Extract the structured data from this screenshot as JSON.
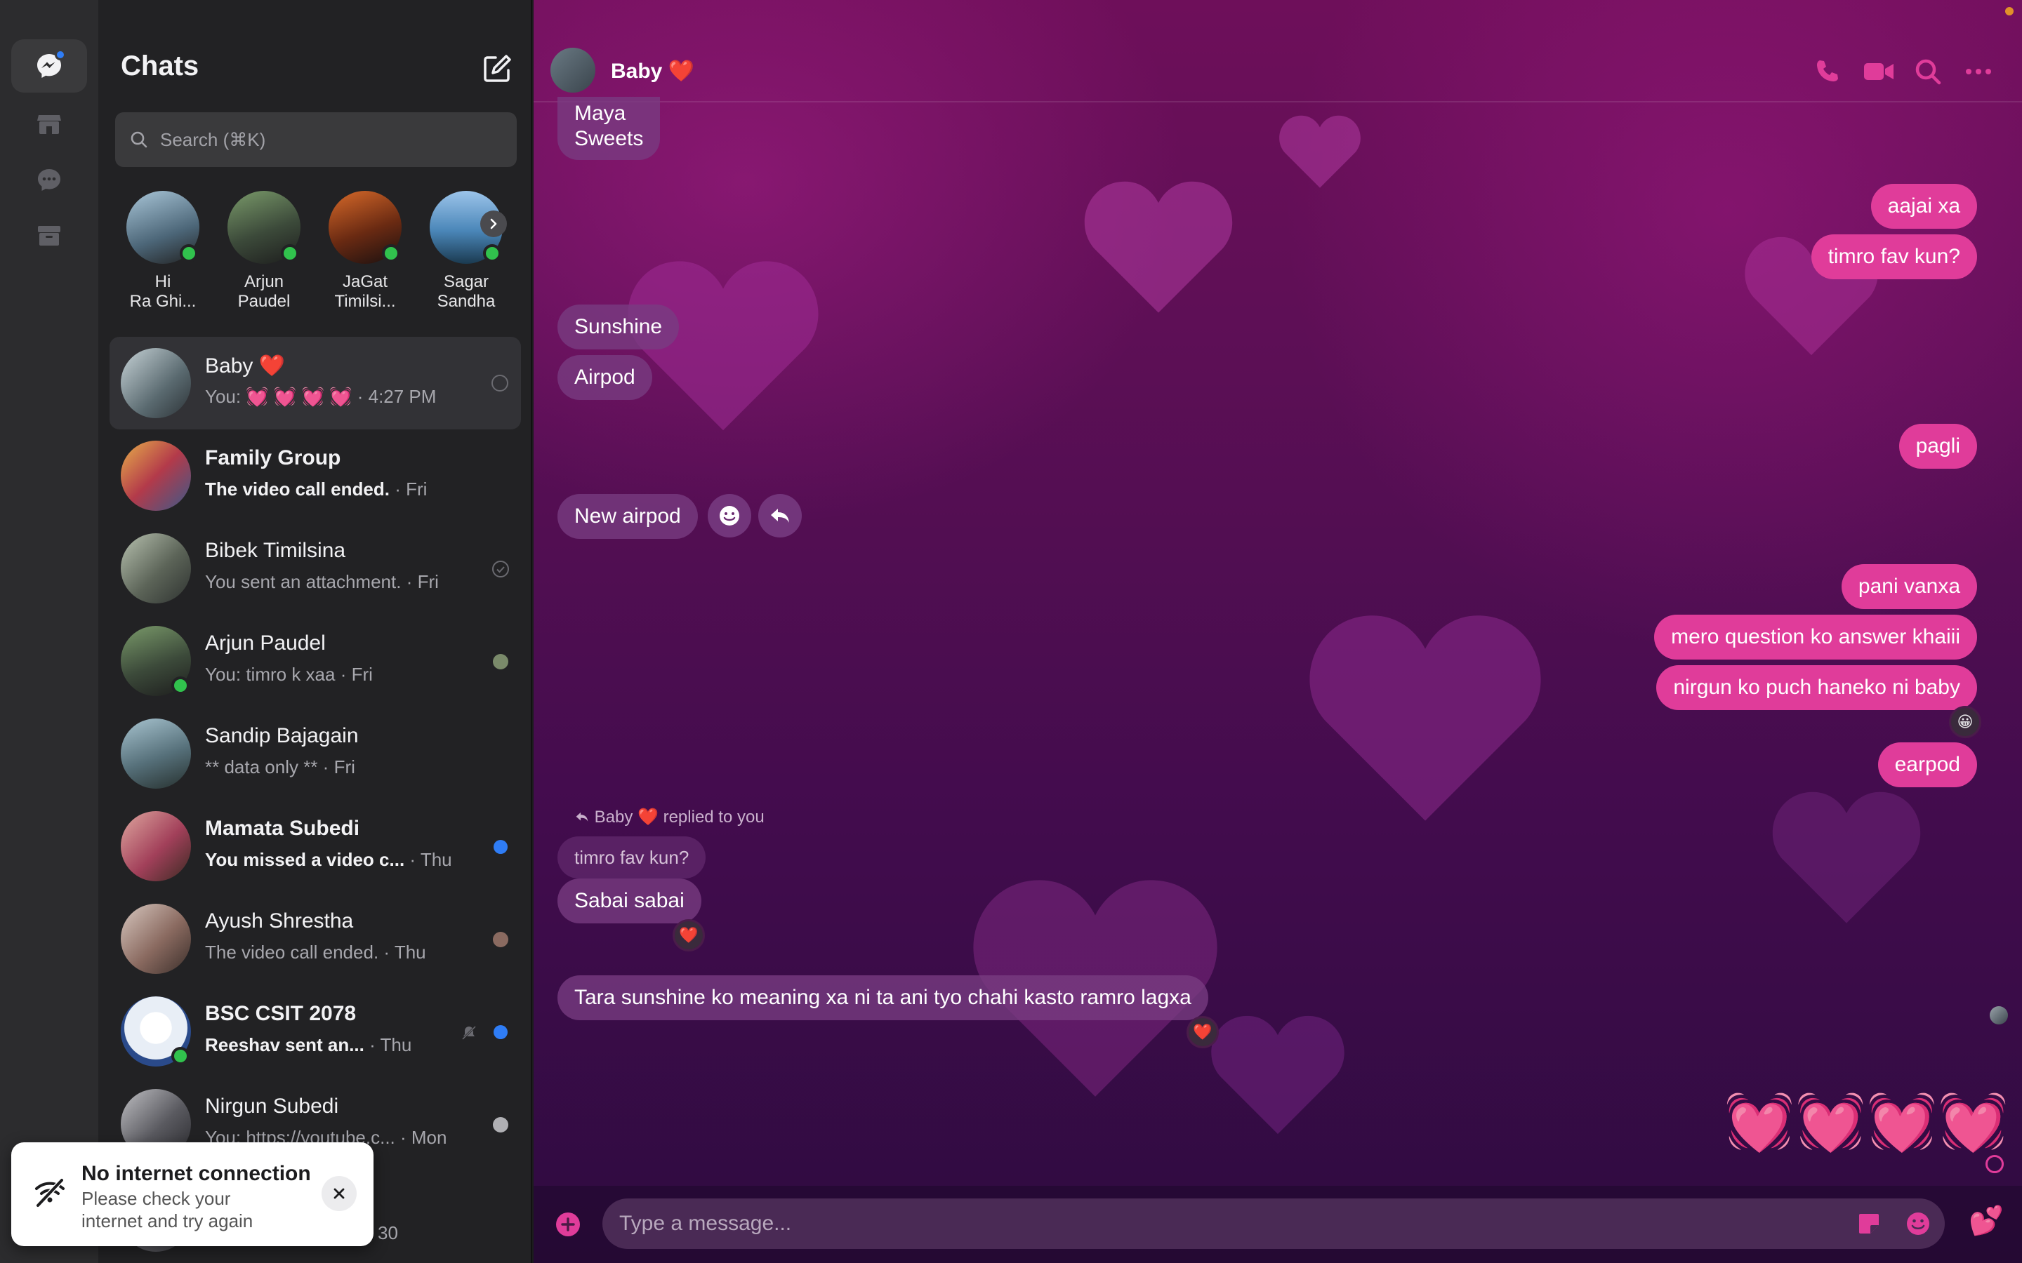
{
  "colors": {
    "accent": "#e03c9a",
    "online": "#31c24d",
    "unread": "#2f7df6"
  },
  "sidebar": {
    "title": "Chats",
    "search_placeholder": "Search (⌘K)",
    "stories": [
      {
        "line1": "Hi",
        "line2": "Ra Ghi..."
      },
      {
        "line1": "Arjun",
        "line2": "Paudel"
      },
      {
        "line1": "JaGat",
        "line2": "Timilsi..."
      },
      {
        "line1": "Sagar",
        "line2": "Sandha"
      }
    ],
    "conversations": [
      {
        "name": "Baby ❤️",
        "preview": "You: 💓 💓 💓 💓",
        "time": "4:27 PM"
      },
      {
        "name": "Family Group",
        "preview": "The video call ended.",
        "time": "Fri"
      },
      {
        "name": "Bibek Timilsina",
        "preview": "You sent an attachment.",
        "time": "Fri"
      },
      {
        "name": "Arjun Paudel",
        "preview": "You: timro k xaa",
        "time": "Fri"
      },
      {
        "name": "Sandip Bajagain",
        "preview": "** data only **",
        "time": "Fri"
      },
      {
        "name": "Mamata Subedi",
        "preview": "You missed a video c...",
        "time": "Thu"
      },
      {
        "name": "Ayush Shrestha",
        "preview": "The video call ended.",
        "time": "Thu"
      },
      {
        "name": "BSC CSIT 2078",
        "preview": "Reeshav sent an...",
        "time": "Thu"
      },
      {
        "name": "Nirgun Subedi",
        "preview": "You: https://youtube.c...",
        "time": "Mon"
      },
      {
        "name": "",
        "preview": "",
        "time": "Mar 30"
      }
    ]
  },
  "toast": {
    "title": "No internet connection",
    "body": "Please check your internet and try again"
  },
  "conversation": {
    "contact_name": "Baby ❤️",
    "messages": {
      "m1": "Maya\nSweets",
      "m2": "aajai xa",
      "m3": "timro fav kun?",
      "m4": "Sunshine",
      "m5": "Airpod",
      "m6": "pagli",
      "m7": "New airpod",
      "m8": "pani vanxa",
      "m9": "mero question ko answer khaiii",
      "m10": "nirgun ko puch haneko ni baby",
      "m11": "earpod",
      "reply_header": "Baby ❤️ replied to you",
      "reply_quote": "timro fav kun?",
      "m12": "Sabai sabai",
      "m13": "Tara sunshine ko meaning xa ni ta ani tyo chahi kasto ramro lagxa",
      "hearts": "💓💓💓💓"
    },
    "reactions": {
      "r1": "😀",
      "r2": "❤️",
      "r3": "❤️"
    },
    "composer_placeholder": "Type a message...",
    "like_emoji": "💕"
  }
}
